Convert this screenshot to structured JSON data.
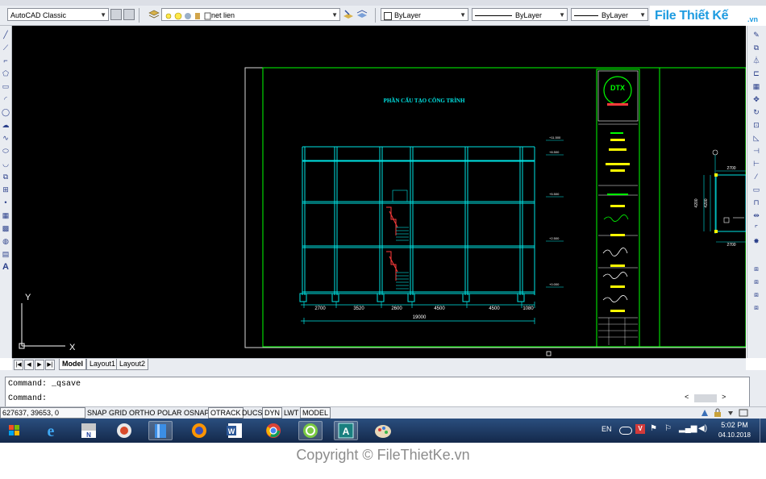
{
  "toolbar": {
    "workspace": "AutoCAD Classic",
    "layer": "net lien",
    "color": "ByLayer",
    "linetype": "ByLayer",
    "lineweight": "ByLayer"
  },
  "logo": {
    "text": "File Thiết Kế",
    "suffix": ".vn"
  },
  "drawing": {
    "sheet_title": "PHẦN CẤU TẠO CÔNG TRÌNH",
    "dimensions": [
      "2700",
      "3520",
      "2600",
      "4500",
      "4500",
      "1080"
    ],
    "total_dimension": "19000",
    "elevation_labels": [
      "+11.500",
      "+8.500",
      "+5.500",
      "+2.500",
      "+0.000"
    ],
    "title_block_logo": "DTX",
    "right_sheet_dims": [
      "2700",
      "2700",
      "4200",
      "4200"
    ],
    "ucs": {
      "x": "X",
      "y": "Y"
    }
  },
  "tabs": {
    "items": [
      "Model",
      "Layout1",
      "Layout2"
    ],
    "active": "Model"
  },
  "command": {
    "history": "Command:  _qsave",
    "prompt": "Command:"
  },
  "status": {
    "coords": "627637, 39653, 0",
    "toggles": [
      "SNAP",
      "GRID",
      "ORTHO",
      "POLAR",
      "OSNAP",
      "OTRACK",
      "DUCS",
      "DYN",
      "LWT",
      "MODEL"
    ]
  },
  "taskbar": {
    "language": "EN",
    "time": "5:02 PM",
    "date": "04.10.2018"
  },
  "footer": {
    "copyright": "Copyright © FileThietKe.vn"
  },
  "colors": {
    "canvas": "#000000",
    "cyan": "#00e5e5",
    "green": "#00ff00",
    "yellow": "#ffff00",
    "red": "#ff3b3b"
  }
}
